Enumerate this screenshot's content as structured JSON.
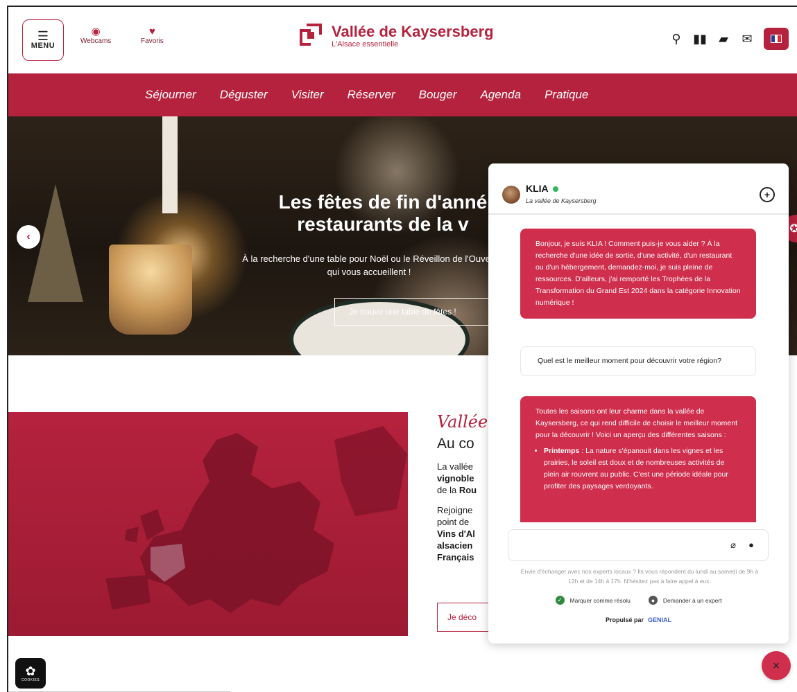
{
  "header": {
    "menu_label": "MENU",
    "webcams_label": "Webcams",
    "favoris_label": "Favoris",
    "logo_title": "Vallée de Kaysersberg",
    "logo_subtitle": "L'Alsace essentielle",
    "icons": [
      "search-icon",
      "map-icon",
      "book-icon",
      "mail-icon",
      "french-flag-icon"
    ]
  },
  "nav": {
    "items": [
      "Séjourner",
      "Déguster",
      "Visiter",
      "Réserver",
      "Bouger",
      "Agenda",
      "Pratique"
    ]
  },
  "hero": {
    "title_line1": "Les fêtes de fin d'anné",
    "title_line2": "restaurants de la v",
    "text_line1": "À la recherche d'une table pour Noël ou le Réveillon de l'Ouvert",
    "text_line2": "qui vous accueillent !",
    "cta": "Je trouve une table de fêtes !"
  },
  "section": {
    "brand": "Vallée",
    "subtitle": "Au co",
    "p1_line1": "La vallée",
    "p1_line2_bold": "vignoble",
    "p1_line3_prefix": "de la ",
    "p1_line3_bold": "Rou",
    "p2_line1": "Rejoigne",
    "p2_line2": "point de",
    "p2_line3": "Vins d'Al",
    "p2_line4": "alsacien",
    "p2_line5": "Français",
    "button": "Je déco"
  },
  "chat": {
    "name": "KLIA",
    "subtitle": "La vallée de Kaysersberg",
    "messages": {
      "bot1": "Bonjour, je suis KLIA ! Comment puis-je vous aider ? À la recherche d'une idée de sortie, d'une activité, d'un restaurant ou d'un hébergement, demandez-moi, je suis pleine de ressources. D'ailleurs, j'ai remporté les Trophées de la Transformation du Grand Est 2024 dans la catégorie Innovation numérique !",
      "user1": "Quel est le meilleur moment pour découvrir votre région?",
      "bot2_intro": "Toutes les saisons ont leur charme dans la vallée de Kaysersberg, ce qui rend difficile de choisir le meilleur moment pour la découvrir ! Voici un aperçu des différentes saisons :",
      "bot2_item_label": "Printemps",
      "bot2_item_text": " : La nature s'épanouit dans les vignes et les prairies, le soleil est doux et de nombreuses activités de plein air rouvrent au public. C'est une période idéale pour profiter des paysages verdoyants."
    },
    "note": "Envie d'échanger avec nos experts locaux ? Ils vous répondent du lundi au samedi de 9h à 12h et de 14h à 17h. N'hésitez pas à faire appel à eux.",
    "resolve_label": "Marquer comme résolu",
    "expert_label": "Demander à un expert",
    "powered_label": "Propulsé par",
    "powered_brand": "GENIAL"
  },
  "cookies_label": "COOKIES",
  "colors": {
    "brand": "#b5223d",
    "chat_bubble": "#cf2e4c",
    "online": "#2eb85c"
  }
}
